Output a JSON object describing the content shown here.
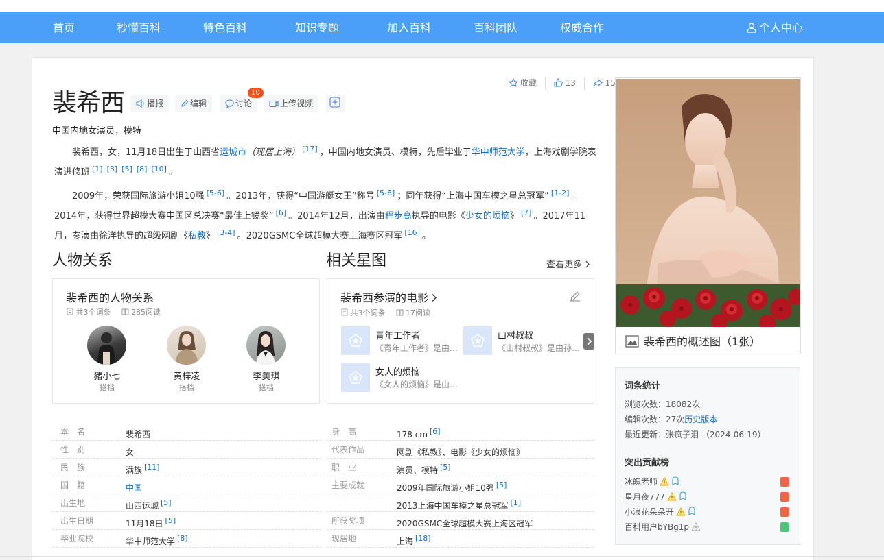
{
  "nav": {
    "items": [
      "首页",
      "秒懂百科",
      "特色百科",
      "知识专题",
      "加入百科",
      "百科团队",
      "权威合作"
    ],
    "user": "个人中心"
  },
  "entry": {
    "title": "裴希西",
    "toolbar": {
      "broadcast": "播报",
      "edit": "编辑",
      "discuss": "讨论",
      "discuss_count": "10",
      "upload_video": "上传视频"
    },
    "actions": {
      "favorite": "收藏",
      "likes": "13",
      "shares": "15"
    },
    "subtitle": "中国内地女演员，模特",
    "para1": {
      "t1": "裴希西，女，11月18日出生于山西省",
      "city": "运城市",
      "t2": "（现居上海）",
      "r1": "[17]",
      "t3": "，中国内地女演员、模特，先后毕业于",
      "school": "华中师范大学",
      "t4": "，上海戏剧学院表演进修班",
      "refs": [
        "[1]",
        "[3]",
        "[5]",
        "[8]",
        "[10]"
      ],
      "end": "。"
    },
    "para2": {
      "t1": "2009年，荣获国际旅游小姐10强",
      "r1": "[5-6]",
      "t2": "。2013年，获得“中国游艇女王”称号",
      "r2": "[5-6]",
      "t3": "；同年获得“上海中国车模之星总冠军”",
      "r3": "[1-2]",
      "t4": "。2014年，获得世界超模大赛中国区总决赛“最佳上镜奖”",
      "r4": "[6]",
      "t5": "。2014年12月，出演由",
      "director": "程步高",
      "t6": "执导的电影《",
      "film": "少女的烦恼",
      "t7": "》",
      "r5": "[7]",
      "t8": "。2017年11月，参演由徐洋执导的超级网剧《",
      "drama": "私教",
      "t9": "》",
      "r6": "[3-4]",
      "t10": "。2020GSMC全球超模大赛上海赛区冠军",
      "r7": "[16]",
      "end": "。"
    }
  },
  "relations": {
    "heading": "人物关系",
    "box_title": "裴希西的人物关系",
    "entries": "共3个词条",
    "reads": "285阅读",
    "people": [
      {
        "name": "猪小七",
        "role": "搭档"
      },
      {
        "name": "黄梓凌",
        "role": "搭档"
      },
      {
        "name": "李美琪",
        "role": "搭档"
      }
    ]
  },
  "star_map": {
    "heading": "相关星图",
    "more": "查看更多",
    "box_title": "裴希西参演的电影",
    "entries": "共3个词条",
    "reads": "17阅读",
    "movies": [
      {
        "title": "青年工作者",
        "desc": "《青年工作者》是由…"
      },
      {
        "title": "山村叔叔",
        "desc": "《山村叔叔》是由孙…"
      },
      {
        "title": "女人的烦恼",
        "desc": "《女人的烦恼》是由…"
      }
    ]
  },
  "basic_info": {
    "left": [
      {
        "key": "本　名",
        "value": "裴希西",
        "ref": ""
      },
      {
        "key": "性　别",
        "value": "女",
        "ref": ""
      },
      {
        "key": "民　族",
        "value": "满族",
        "ref": "[11]"
      },
      {
        "key": "国　籍",
        "value": "中国",
        "ref": ""
      },
      {
        "key": "出生地",
        "value": "山西运城",
        "ref": "[5]"
      },
      {
        "key": "出生日期",
        "value": "11月18日",
        "ref": "[5]"
      },
      {
        "key": "毕业院校",
        "value": "华中师范大学",
        "ref": "[8]"
      }
    ],
    "right": [
      {
        "key": "身　高",
        "value": "178 cm",
        "ref": "[6]"
      },
      {
        "key": "代表作品",
        "value": "网剧《私教》、电影《少女的烦恼》",
        "ref": ""
      },
      {
        "key": "职　业",
        "value": "演员、模特",
        "ref": "[5]"
      },
      {
        "key": "主要成就",
        "value": "2009年国际旅游小姐10强",
        "ref": "[5]"
      },
      {
        "key": "",
        "value": "2013上海中国车模之星总冠军",
        "ref": "[1]"
      },
      {
        "key": "所获奖项",
        "value": "2020GSMC全球超模大赛上海区冠军",
        "ref": ""
      },
      {
        "key": "现居地",
        "value": "上海",
        "ref": "[18]"
      }
    ]
  },
  "photo": {
    "caption": "裴希西的概述图（1张）"
  },
  "stats": {
    "heading": "词条统计",
    "views_label": "浏览次数：",
    "views": "18082次",
    "edits_label": "编辑次数：",
    "edits": "27次",
    "history": "历史版本",
    "updated_label": "最近更新：",
    "updated": "张疯子泪 （2024-06-19）",
    "contrib_heading": "突出贡献榜",
    "contributors": [
      "冰魄老师",
      "星月夜777",
      "小浪花朵朵开",
      "百科用户bYBg1p"
    ]
  },
  "colors": {
    "nav": "#4a9ff6",
    "link": "#136ec2",
    "badge": "#f0541e"
  }
}
